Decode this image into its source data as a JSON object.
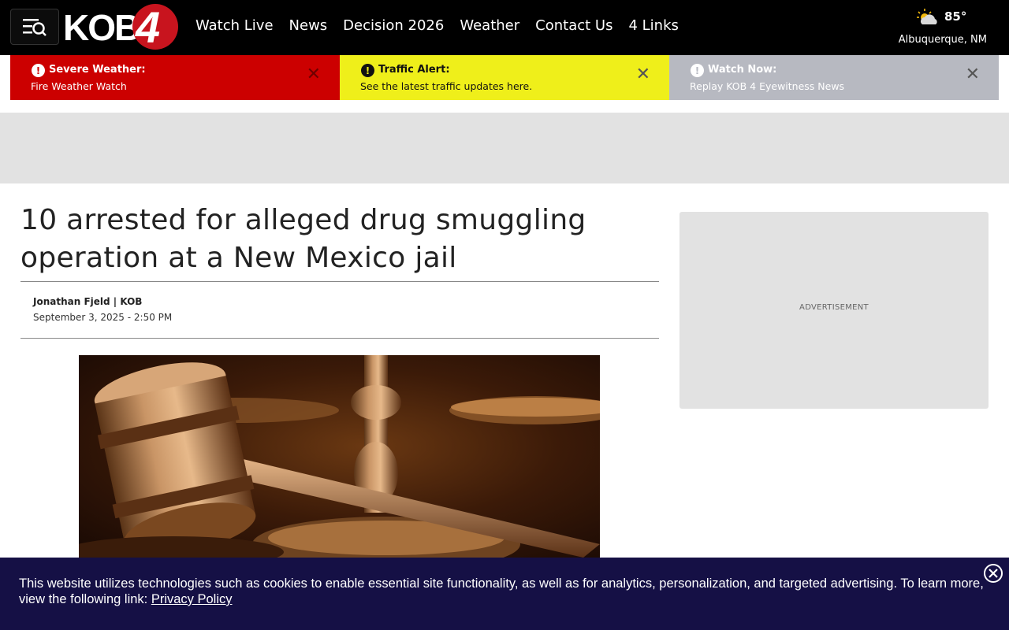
{
  "header": {
    "logo_text": "KOB",
    "logo_number": "4",
    "nav": [
      "Watch Live",
      "News",
      "Decision 2026",
      "Weather",
      "Contact Us",
      "4 Links"
    ],
    "weather": {
      "temp": "85°",
      "city": "Albuquerque, NM",
      "icon": "partly-cloudy-icon"
    }
  },
  "alerts": [
    {
      "title": "Severe Weather:",
      "text": "Fire Weather Watch",
      "color": "#cc0000"
    },
    {
      "title": "Traffic Alert:",
      "text": "See the latest traffic updates here.",
      "color": "#efef1a"
    },
    {
      "title": "Watch Now:",
      "text": "Replay KOB 4 Eyewitness News",
      "color": "#b7b9c1"
    }
  ],
  "article": {
    "headline": "10 arrested for alleged drug smuggling operation at a New Mexico jail",
    "byline": "Jonathan Fjeld | KOB",
    "date": "September 3, 2025 - 2:50 PM"
  },
  "sidebar": {
    "ad_label": "ADVERTISEMENT"
  },
  "cookie_banner": {
    "text": "This website utilizes technologies such as cookies to enable essential site functionality, as well as for analytics, personalization, and targeted advertising. To learn more, view the following link: ",
    "link": "Privacy Policy"
  }
}
